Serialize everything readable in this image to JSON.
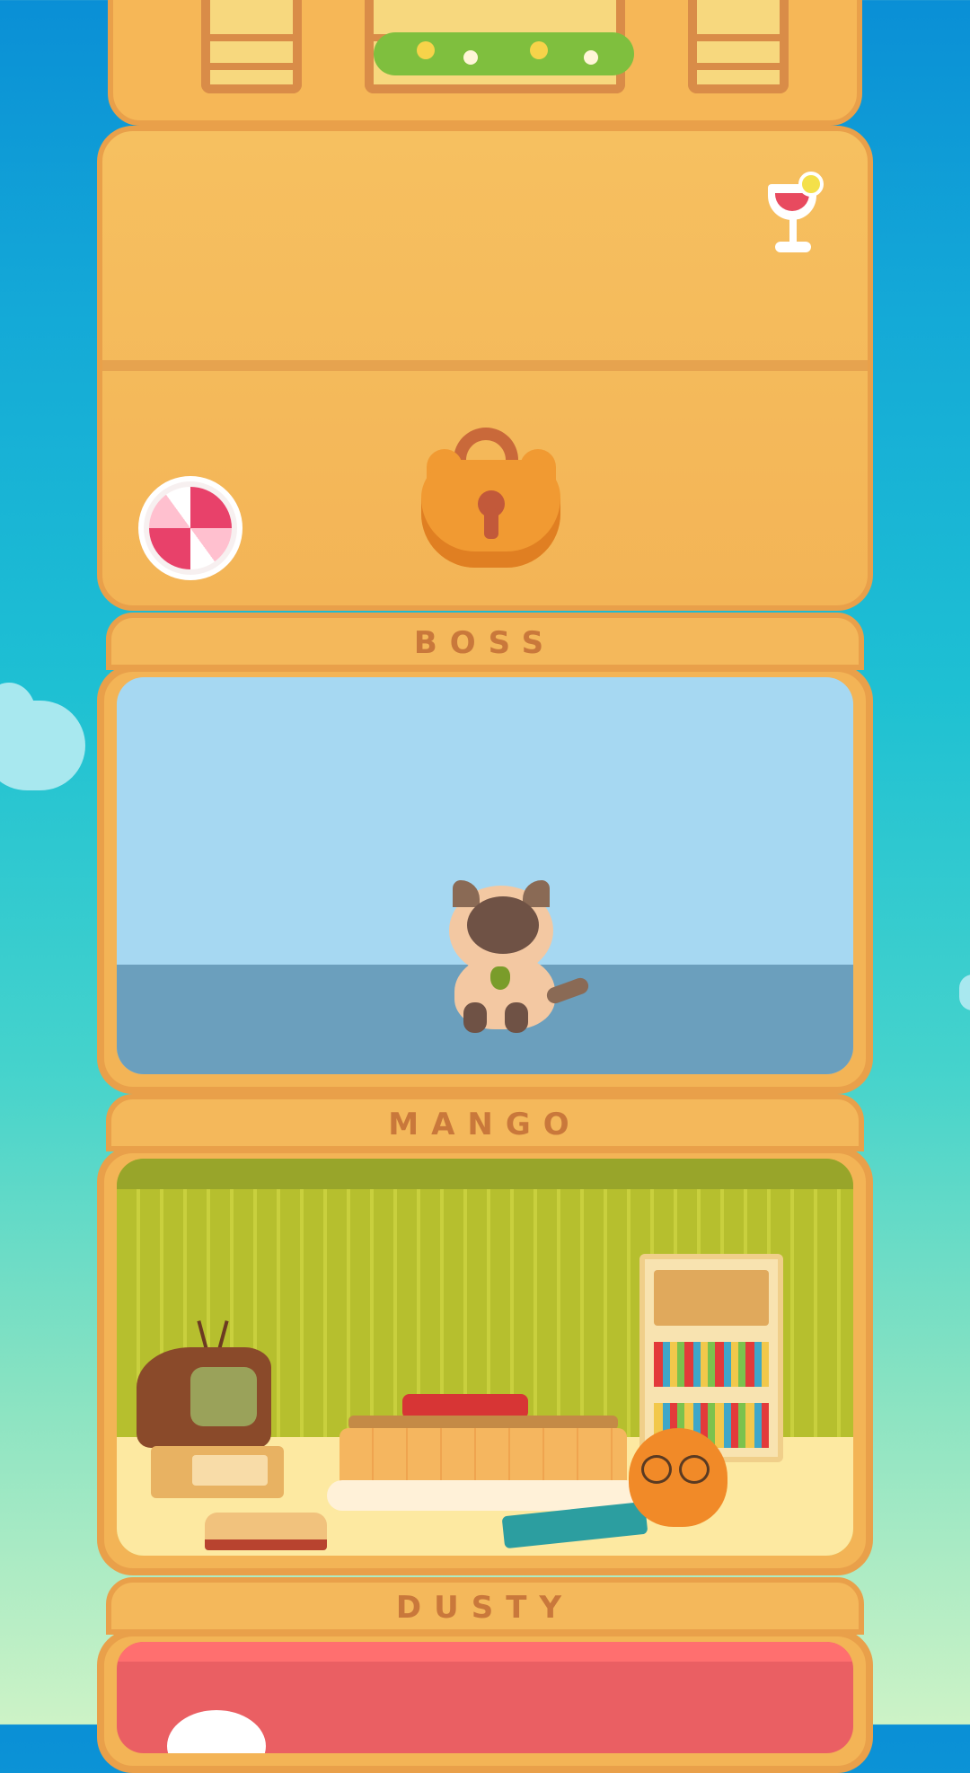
{
  "rooms": [
    {
      "name": "BOSS",
      "scene": "ocean",
      "colors": {
        "sky": "#a6d8f2",
        "sea": "#6b9fbd"
      }
    },
    {
      "name": "MANGO",
      "scene": "living-room",
      "colors": {
        "wall": "#b6bf2e",
        "floor": "#fde9a1"
      }
    },
    {
      "name": "DUSTY",
      "scene": "red-room",
      "colors": {
        "wall": "#ea5f63"
      }
    }
  ],
  "locked_floor": {
    "state": "locked",
    "icon": "lock-icon",
    "decor": [
      "cocktail-icon",
      "beach-ball-icon"
    ]
  },
  "colors": {
    "wood": "#f3b456",
    "wood_dark": "#e9a04a",
    "label_text": "#c9783b"
  }
}
